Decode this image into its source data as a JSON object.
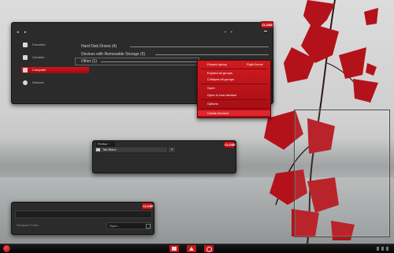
{
  "explorer": {
    "close_label": "CLOSE",
    "nav_back": "◂",
    "nav_forward": "▸",
    "sidebar": [
      {
        "label": "Favorites",
        "icon": "star-icon"
      },
      {
        "label": "Libraries",
        "icon": "library-icon"
      },
      {
        "label": "Computer",
        "icon": "computer-icon",
        "active": true
      },
      {
        "label": "Network",
        "icon": "network-icon"
      }
    ],
    "groups": [
      {
        "label": "Hard Disk Drives (4)"
      },
      {
        "label": "Devices with Removable Storage (5)"
      },
      {
        "label": "Other (1)"
      }
    ]
  },
  "context_menu": {
    "header_left": "Expand group",
    "header_right": "Right Arrow",
    "items": [
      {
        "label": "Expand all groups"
      },
      {
        "label": "Collapse all groups"
      },
      {
        "label": "Open"
      },
      {
        "label": "Open in new window"
      },
      {
        "label": "Options"
      },
      {
        "label": "Create shortcut"
      }
    ]
  },
  "browser": {
    "tab_label": "Firefox",
    "close_label": "CLOSE",
    "page_tab_label": "Tab Blanc",
    "new_tab": "+"
  },
  "dialog": {
    "close_label": "CLOSE",
    "field_label": "Navigate Folder",
    "open_label": "Open..."
  },
  "colors": {
    "accent": "#c5161d",
    "window_bg": "#2b2b2b",
    "taskbar_bg": "#0b0b0b"
  }
}
